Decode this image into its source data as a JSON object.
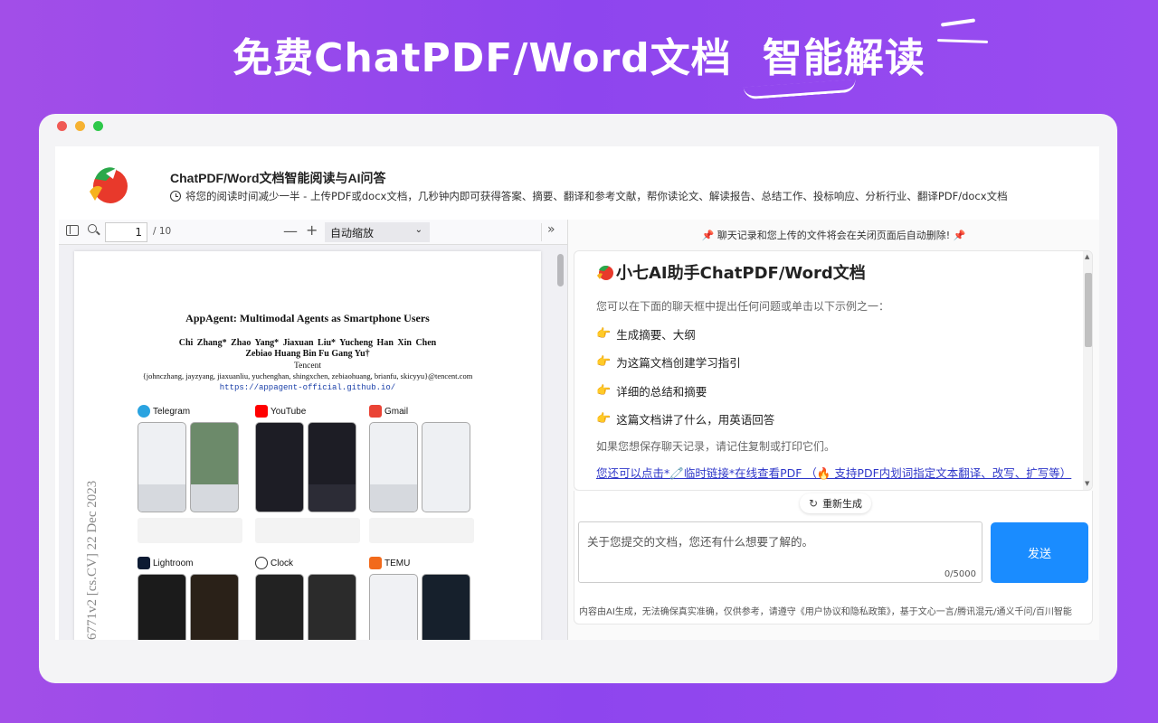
{
  "banner": {
    "title_main": "免费ChatPDF/Word文档",
    "title_highlight": "智能解读"
  },
  "app": {
    "title": "ChatPDF/Word文档智能阅读与AI问答",
    "subtitle": "将您的阅读时间减少一半 - 上传PDF或docx文档，几秒钟内即可获得答案、摘要、翻译和参考文献，帮你读论文、解读报告、总结工作、投标响应、分析行业、翻译PDF/docx文档"
  },
  "pdf_viewer": {
    "page_current": "1",
    "page_total": "/ 10",
    "zoom_label": "自动缩放",
    "paper": {
      "title": "AppAgent: Multimodal Agents as Smartphone Users",
      "authors_line1": "Chi Zhang*   Zhao Yang*   Jiaxuan Liu*   Yucheng Han   Xin Chen",
      "authors_line2": "Zebiao Huang   Bin Fu   Gang Yu†",
      "affiliation": "Tencent",
      "emails": "{johnczhang, jayzyang, jiaxuanliu, yuchenghan, shingxchen, zebiaohuang, brianfu, skicyyu}@tencent.com",
      "url": "https://appagent-official.github.io/",
      "arxiv_stamp": "6771v2  [cs.CV]  22 Dec 2023",
      "figure_apps": [
        "Telegram",
        "YouTube",
        "Gmail",
        "Lightroom",
        "Clock",
        "TEMU"
      ]
    }
  },
  "chat": {
    "notice": "聊天记录和您上传的文件将会在关闭页面后自动删除!",
    "title": "小七AI助手ChatPDF/Word文档",
    "intro": "您可以在下面的聊天框中提出任何问题或单击以下示例之一：",
    "examples": [
      "生成摘要、大纲",
      "为这篇文档创建学习指引",
      "详细的总结和摘要",
      "这篇文档讲了什么，用英语回答"
    ],
    "save_tip": "如果您想保存聊天记录，请记住复制或打印它们。",
    "link_text": "您还可以点击*🧷临时链接*在线查看PDF （🔥 支持PDF内划词指定文本翻译、改写、扩写等）",
    "regen_label": "重新生成",
    "input_placeholder": "关于您提交的文档，您还有什么想要了解的。",
    "char_count": "0/5000",
    "send_label": "发送",
    "disclaimer": "内容由AI生成，无法确保真实准确，仅供参考，请遵守《用户协议和隐私政策》，基于文心一言/腾讯混元/通义千问/百川智能"
  },
  "colors": {
    "background_accent": "#9a4cf0",
    "send_button": "#1a8cff",
    "link": "#2f37c9"
  }
}
